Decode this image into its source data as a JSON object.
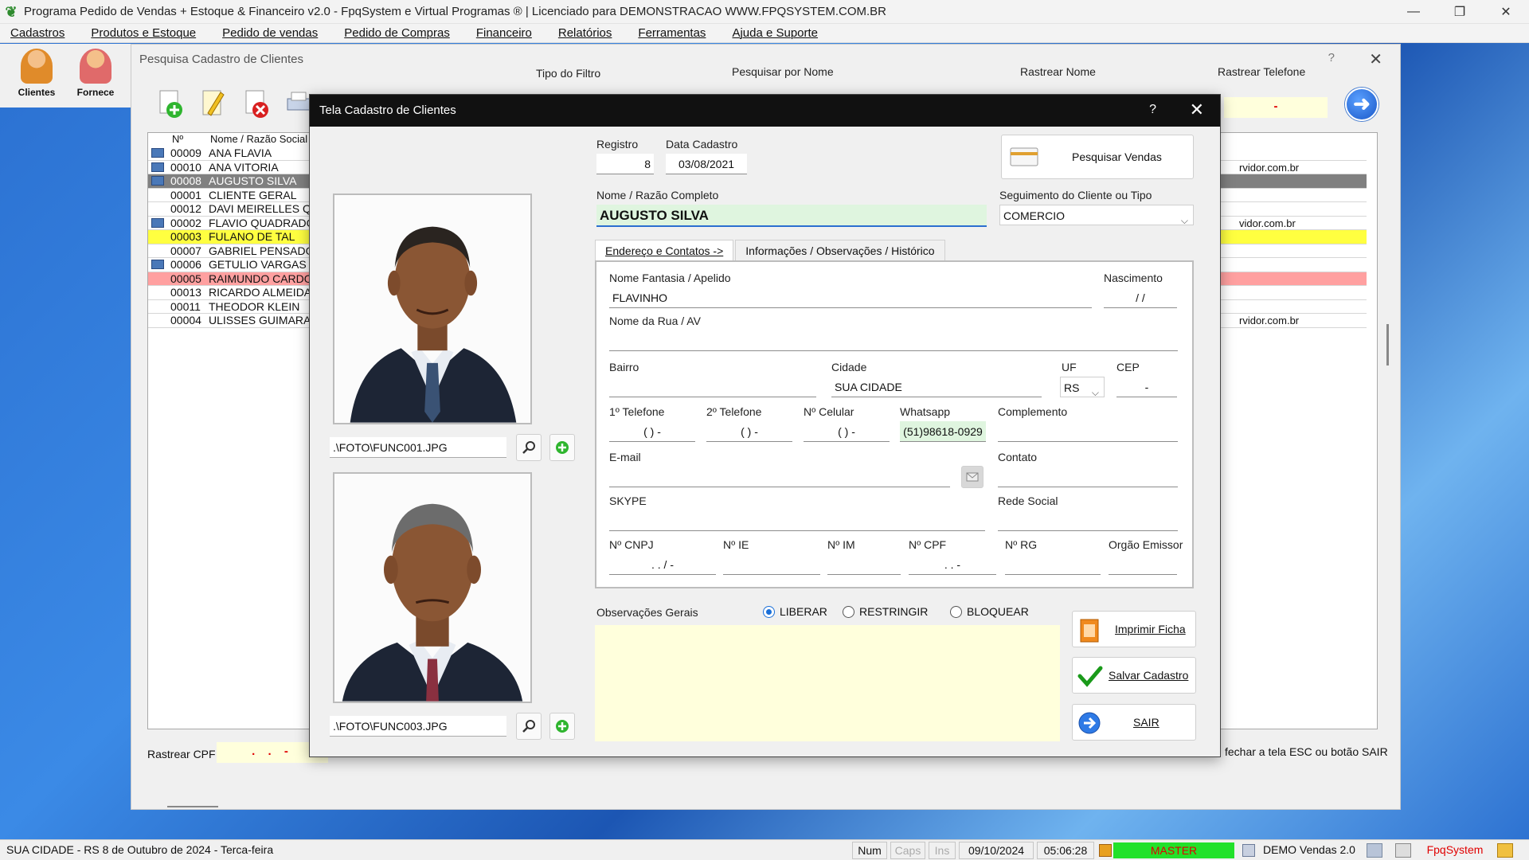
{
  "window": {
    "title": "Programa Pedido de Vendas + Estoque & Financeiro v2.0 - FpqSystem e Virtual Programas ® | Licenciado para  DEMONSTRACAO WWW.FPQSYSTEM.COM.BR"
  },
  "menu": [
    "Cadastros",
    "Produtos e Estoque",
    "Pedido de vendas",
    "Pedido de Compras",
    "Financeiro",
    "Relatórios",
    "Ferramentas",
    "Ajuda e Suporte"
  ],
  "sidebar": {
    "clientes": "Clientes",
    "fornece": "Fornece"
  },
  "pesquisa": {
    "title": "Pesquisa Cadastro de Clientes",
    "help": "?",
    "tipo_filtro": "Tipo do Filtro",
    "pesquisar_nome": "Pesquisar por Nome",
    "rastrear_nome": "Rastrear Nome",
    "rastrear_telefone": "Rastrear Telefone",
    "telefone_value": "-",
    "headers": {
      "num": "Nº",
      "nome": "Nome / Razão Social"
    },
    "rows": [
      {
        "num": "00009",
        "nome": "ANA FLAVIA",
        "email": "",
        "icon": true,
        "state": "normal"
      },
      {
        "num": "00010",
        "nome": "ANA VITORIA",
        "email": "rvidor.com.br",
        "icon": true,
        "state": "normal"
      },
      {
        "num": "00008",
        "nome": "AUGUSTO SILVA",
        "email": "",
        "icon": true,
        "state": "selected"
      },
      {
        "num": "00001",
        "nome": "CLIENTE GERAL",
        "email": "",
        "icon": false,
        "state": "normal"
      },
      {
        "num": "00012",
        "nome": "DAVI MEIRELLES QU",
        "email": "",
        "icon": false,
        "state": "normal"
      },
      {
        "num": "00002",
        "nome": "FLAVIO QUADRADO",
        "email": "vidor.com.br",
        "icon": true,
        "state": "normal"
      },
      {
        "num": "00003",
        "nome": "FULANO DE TAL",
        "email": "",
        "icon": false,
        "state": "yellow"
      },
      {
        "num": "00007",
        "nome": "GABRIEL PENSADO",
        "email": "",
        "icon": false,
        "state": "normal"
      },
      {
        "num": "00006",
        "nome": "GETULIO VARGAS",
        "email": "",
        "icon": true,
        "state": "normal"
      },
      {
        "num": "00005",
        "nome": "RAIMUNDO CARDOS",
        "email": "",
        "icon": false,
        "state": "red"
      },
      {
        "num": "00013",
        "nome": "RICARDO ALMEIDA",
        "email": "",
        "icon": false,
        "state": "normal"
      },
      {
        "num": "00011",
        "nome": "THEODOR KLEIN",
        "email": "",
        "icon": false,
        "state": "normal"
      },
      {
        "num": "00004",
        "nome": "ULISSES GUIMARAE",
        "email": "rvidor.com.br",
        "icon": false,
        "state": "normal"
      }
    ],
    "rastrear_cpf_label": "Rastrear CPF",
    "rastrear_cpf_value": ". . -",
    "hint": "fechar a tela ESC ou botão SAIR"
  },
  "dialog": {
    "title": "Tela Cadastro de Clientes",
    "help": "?",
    "foto1_path": ".\\FOTO\\FUNC001.JPG",
    "foto2_path": ".\\FOTO\\FUNC003.JPG",
    "registro_label": "Registro",
    "registro_value": "8",
    "data_cadastro_label": "Data Cadastro",
    "data_cadastro_value": "03/08/2021",
    "pesquisar_vendas": "Pesquisar Vendas",
    "nome_label": "Nome / Razão Completo",
    "nome_value": "AUGUSTO SILVA",
    "seguimento_label": "Seguimento do Cliente ou Tipo",
    "seguimento_value": "COMERCIO",
    "tabs": [
      "Endereço e Contatos ->",
      "Informações / Observações / Histórico"
    ],
    "fields": {
      "fantasia_label": "Nome Fantasia / Apelido",
      "fantasia_value": "FLAVINHO",
      "nascimento_label": "Nascimento",
      "nascimento_value": "/ /",
      "rua_label": "Nome da Rua / AV",
      "rua_value": "",
      "bairro_label": "Bairro",
      "bairro_value": "",
      "cidade_label": "Cidade",
      "cidade_value": "SUA CIDADE",
      "uf_label": "UF",
      "uf_value": "RS",
      "cep_label": "CEP",
      "cep_value": "-",
      "tel1_label": "1º Telefone",
      "tel1_value": "( )  -",
      "tel2_label": "2º Telefone",
      "tel2_value": "( )  -",
      "celular_label": "Nº Celular",
      "celular_value": "( )  -",
      "whatsapp_label": "Whatsapp",
      "whatsapp_value": "(51)98618-0929",
      "complemento_label": "Complemento",
      "complemento_value": "",
      "email_label": "E-mail",
      "email_value": "",
      "contato_label": "Contato",
      "contato_value": "",
      "skype_label": "SKYPE",
      "skype_value": "",
      "rede_label": "Rede Social",
      "rede_value": "",
      "cnpj_label": "Nº CNPJ",
      "cnpj_value": ". .  /  -",
      "ie_label": "Nº IE",
      "ie_value": "",
      "im_label": "Nº IM",
      "im_value": "",
      "cpf_label": "Nº CPF",
      "cpf_value": ". .  -",
      "rg_label": "Nº RG",
      "rg_value": "",
      "orgao_label": "Orgão Emissor",
      "orgao_value": ""
    },
    "obs_label": "Observações Gerais",
    "radios": {
      "liberar": "LIBERAR",
      "restringir": "RESTRINGIR",
      "bloquear": "BLOQUEAR",
      "selected": "LIBERAR"
    },
    "buttons": {
      "imprimir": "Imprimir Ficha",
      "salvar": "Salvar Cadastro",
      "sair": "SAIR"
    }
  },
  "statusbar": {
    "location": "SUA CIDADE - RS  8 de Outubro de 2024 - Terca-feira",
    "num": "Num",
    "caps": "Caps",
    "ins": "Ins",
    "date": "09/10/2024",
    "time": "05:06:28",
    "master": "MASTER",
    "demo": "DEMO Vendas 2.0",
    "brand": "FpqSystem"
  },
  "colors": {
    "selected_row": "#808080",
    "yellow_row": "#ffff40",
    "red_row": "#ffa0a0",
    "yellow_field": "#ffffdc",
    "master_green": "#22e12a"
  }
}
